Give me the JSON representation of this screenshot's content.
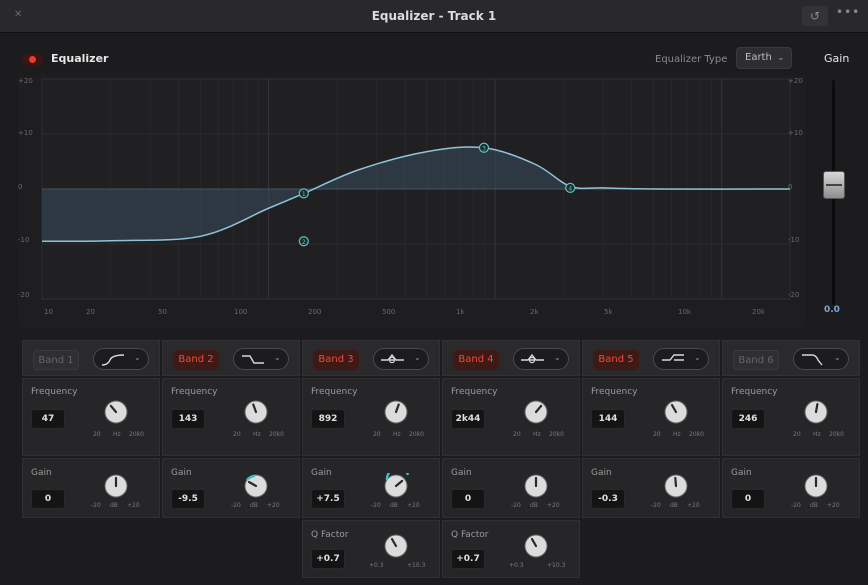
{
  "window": {
    "title": "Equalizer - Track 1"
  },
  "header": {
    "eq_label": "Equalizer",
    "eq_enabled": true,
    "eq_type_label": "Equalizer Type",
    "eq_type_value": "Earth",
    "gain_title": "Gain"
  },
  "graph": {
    "db_left": [
      "+20",
      "+10",
      "0",
      "-10",
      "-20"
    ],
    "db_right": [
      "+20",
      "+10",
      "0",
      "-10",
      "-20"
    ],
    "freq_ticks": [
      "10",
      "20",
      "50",
      "100",
      "200",
      "500",
      "1k",
      "2k",
      "5k",
      "10k",
      "20k"
    ],
    "nodes": [
      "2",
      "1",
      "3",
      "4"
    ],
    "curve": [
      {
        "hz": 10,
        "db": -9.5
      },
      {
        "hz": 20,
        "db": -9.4
      },
      {
        "hz": 50,
        "db": -8.6
      },
      {
        "hz": 100,
        "db": -3.5
      },
      {
        "hz": 143,
        "db": -0.8
      },
      {
        "hz": 250,
        "db": 3.5
      },
      {
        "hz": 500,
        "db": 6.8
      },
      {
        "hz": 892,
        "db": 7.5
      },
      {
        "hz": 1500,
        "db": 4.5
      },
      {
        "hz": 2144,
        "db": 0.5
      },
      {
        "hz": 3000,
        "db": 0.2
      },
      {
        "hz": 5000,
        "db": 0
      },
      {
        "hz": 20000,
        "db": 0
      }
    ],
    "colors": {
      "curve": "#8fc4d8",
      "node": "#5fc2bd",
      "fill": "#3a4d5e"
    }
  },
  "fader": {
    "value": "0.0",
    "accent": "#7aa8d8"
  },
  "labels": {
    "frequency": "Frequency",
    "gain": "Gain",
    "q_factor": "Q Factor",
    "hz": "Hz",
    "db": "dB",
    "freq_min": "20",
    "freq_max": "20k0",
    "gain_min": "-20",
    "gain_max": "+20",
    "q_min": "+0.3",
    "q_max": "+10.3"
  },
  "bands": [
    {
      "name": "Band 1",
      "on": false,
      "shape": "low-cut-icon",
      "frequency": "47",
      "gain": "0",
      "q": ""
    },
    {
      "name": "Band 2",
      "on": true,
      "shape": "low-shelf-icon",
      "frequency": "143",
      "gain": "-9.5",
      "q": ""
    },
    {
      "name": "Band 3",
      "on": true,
      "shape": "bell-icon",
      "frequency": "892",
      "gain": "+7.5",
      "q": "+0.7"
    },
    {
      "name": "Band 4",
      "on": true,
      "shape": "bell-icon",
      "frequency": "2k44",
      "gain": "0",
      "q": "+0.7"
    },
    {
      "name": "Band 5",
      "on": true,
      "shape": "high-shelf-icon",
      "frequency": "144",
      "gain": "-0.3",
      "q": ""
    },
    {
      "name": "Band 6",
      "on": false,
      "shape": "high-cut-icon",
      "frequency": "246",
      "gain": "0",
      "q": ""
    }
  ]
}
